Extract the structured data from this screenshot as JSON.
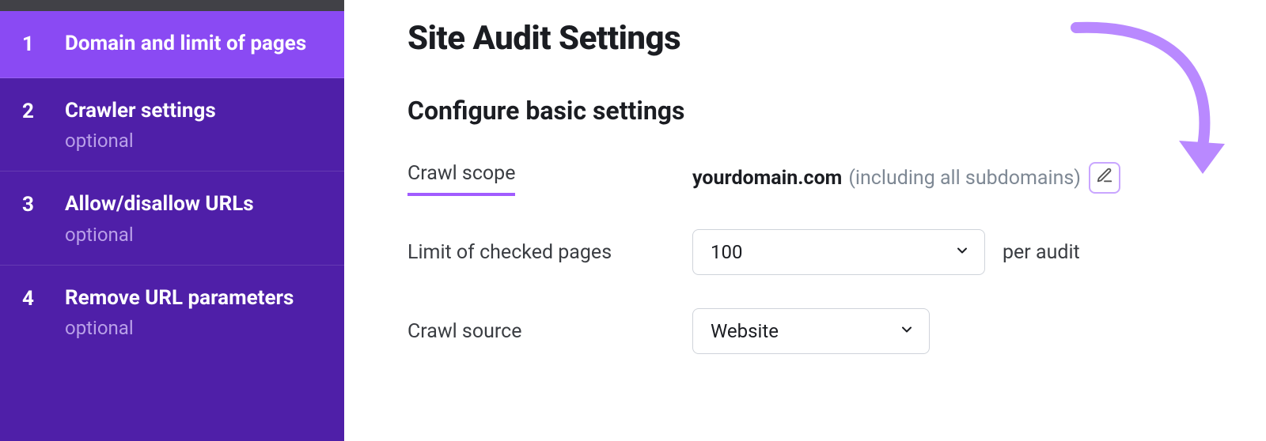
{
  "sidebar": {
    "steps": [
      {
        "num": "1",
        "label": "Domain and limit of pages",
        "optional": ""
      },
      {
        "num": "2",
        "label": "Crawler settings",
        "optional": "optional"
      },
      {
        "num": "3",
        "label": "Allow/disallow URLs",
        "optional": "optional"
      },
      {
        "num": "4",
        "label": "Remove URL parameters",
        "optional": "optional"
      }
    ]
  },
  "main": {
    "title": "Site Audit Settings",
    "subtitle": "Configure basic settings",
    "crawl_scope_label": "Crawl scope",
    "crawl_scope_domain": "yourdomain.com",
    "crawl_scope_note": "(including all subdomains)",
    "limit_label": "Limit of checked pages",
    "limit_value": "100",
    "limit_suffix": "per audit",
    "source_label": "Crawl source",
    "source_value": "Website"
  }
}
